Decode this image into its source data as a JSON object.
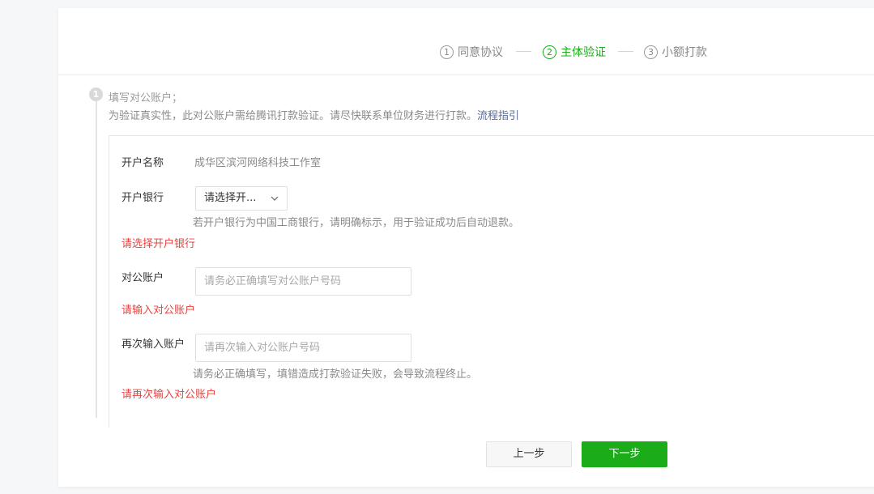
{
  "steps": [
    {
      "num": "1",
      "label": "同意协议",
      "state": "done"
    },
    {
      "num": "2",
      "label": "主体验证",
      "state": "active"
    },
    {
      "num": "3",
      "label": "小额打款",
      "state": "todo"
    }
  ],
  "section": {
    "marker": "1",
    "title": "填写对公账户；",
    "description": "为验证真实性，此对公账户需给腾讯打款验证。请尽快联系单位财务进行打款。",
    "guide_link": "流程指引"
  },
  "form": {
    "account_name": {
      "label": "开户名称",
      "value": "成华区滨河网络科技工作室"
    },
    "bank": {
      "label": "开户银行",
      "selected": "请选择开...",
      "hint": "若开户银行为中国工商银行，请明确标示，用于验证成功后自动退款。",
      "error": "请选择开户银行"
    },
    "account": {
      "label": "对公账户",
      "placeholder": "请务必正确填写对公账户号码",
      "error": "请输入对公账户"
    },
    "account_confirm": {
      "label": "再次输入账户",
      "placeholder": "请再次输入对公账户号码",
      "hint": "请务必正确填写，填错造成打款验证失败，会导致流程终止。",
      "error": "请再次输入对公账户"
    }
  },
  "buttons": {
    "prev": "上一步",
    "next": "下一步"
  },
  "colors": {
    "accent": "#1aad19",
    "error": "#e64340",
    "link": "#576b95"
  },
  "icons": {
    "select_chevron": "chevron-down-icon",
    "step_marker": "circled-number-icon"
  }
}
